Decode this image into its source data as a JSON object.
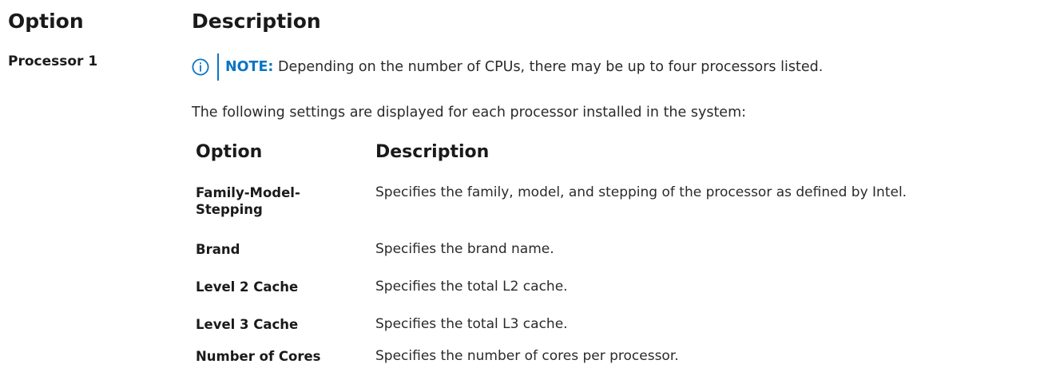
{
  "outer_table": {
    "headers": {
      "option": "Option",
      "description": "Description"
    }
  },
  "processor": {
    "label": "Processor 1",
    "note": {
      "icon": "info-circle-icon",
      "label": "NOTE:",
      "text": " Depending on the number of CPUs, there may be up to four processors listed."
    },
    "intro": "The following settings are displayed for each processor installed in the system:"
  },
  "inner_table": {
    "headers": {
      "option": "Option",
      "description": "Description"
    },
    "rows": [
      {
        "option_line1": "Family-Model-",
        "option_line2": "Stepping",
        "description": "Specifies the family, model, and stepping of the processor as defined by Intel."
      },
      {
        "option": "Brand",
        "description": "Specifies the brand name."
      },
      {
        "option": "Level 2 Cache",
        "description": "Specifies the total L2 cache."
      },
      {
        "option": "Level 3 Cache",
        "description": "Specifies the total L3 cache."
      },
      {
        "option": "Number of Cores",
        "description": "Specifies the number of cores per processor."
      }
    ]
  },
  "colors": {
    "accent": "#0b74c4",
    "text": "#2a2a2a",
    "heading": "#1a1a1a"
  }
}
